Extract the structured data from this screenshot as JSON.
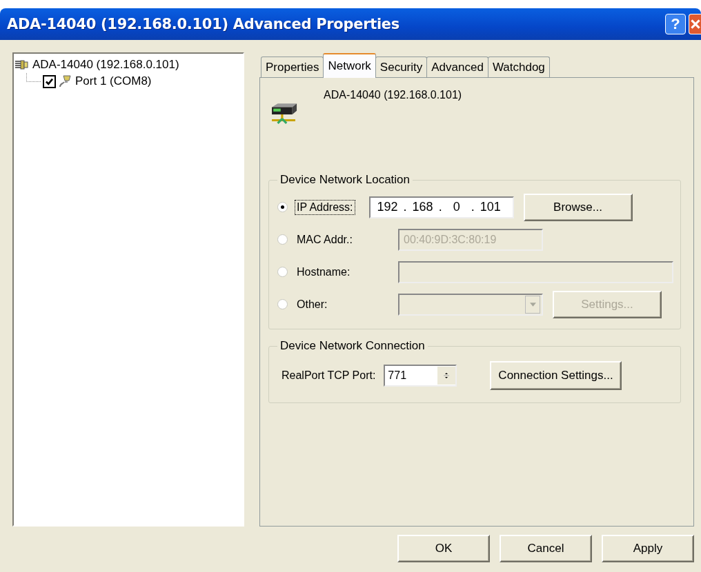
{
  "window": {
    "title": "ADA-14040 (192.168.0.101) Advanced Properties",
    "help": "?"
  },
  "tree": [
    {
      "label": "ADA-14040 (192.168.0.101)",
      "kind": "device",
      "children": [
        {
          "label": "Port 1 (COM8)",
          "kind": "port",
          "checked": true
        }
      ]
    }
  ],
  "tabs": [
    {
      "label": "Properties",
      "selected": false
    },
    {
      "label": "Network",
      "selected": true
    },
    {
      "label": "Security",
      "selected": false
    },
    {
      "label": "Advanced",
      "selected": false
    },
    {
      "label": "Watchdog",
      "selected": false
    }
  ],
  "device_name": "ADA-14040 (192.168.0.101)",
  "location": {
    "title": "Device Network Location",
    "options": [
      {
        "label": "IP Address:",
        "selected": true,
        "kind": "ip",
        "octets": [
          "192",
          "168",
          "0",
          "101"
        ],
        "separator": ".",
        "disabled": false,
        "button": {
          "label": "Browse...",
          "disabled": false
        }
      },
      {
        "label": "MAC Addr.:",
        "selected": false,
        "kind": "text",
        "value": "00:40:9D:3C:80:19",
        "disabled": true
      },
      {
        "label": "Hostname:",
        "selected": false,
        "kind": "wide",
        "disabled": true
      },
      {
        "label": "Other:",
        "selected": false,
        "kind": "dropdown",
        "disabled": true,
        "button": {
          "label": "Settings...",
          "disabled": true
        }
      }
    ]
  },
  "connection": {
    "title": "Device Network Connection",
    "port_label": "RealPort TCP Port:",
    "port_value": "771",
    "button": "Connection Settings..."
  },
  "buttons": [
    "OK",
    "Cancel",
    "Apply"
  ]
}
